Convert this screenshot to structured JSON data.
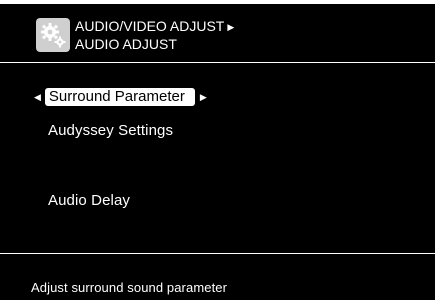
{
  "header": {
    "icon": "settings-gear-icon",
    "breadcrumb_parent": "AUDIO/VIDEO ADJUST",
    "breadcrumb_arrow": "▶",
    "title": "AUDIO ADJUST"
  },
  "menu": {
    "items": [
      {
        "label": "Surround Parameter",
        "selected": true
      },
      {
        "label": "Audyssey Settings",
        "selected": false
      },
      {
        "label": "Audio Delay",
        "selected": false
      }
    ],
    "left_arrow": "◀",
    "right_arrow": "▶"
  },
  "footer": {
    "help_text": "Adjust surround sound parameter"
  },
  "colors": {
    "background": "#000000",
    "text": "#ffffff",
    "selection": "#ffffff",
    "icon_bg": "#cfcfcf"
  }
}
